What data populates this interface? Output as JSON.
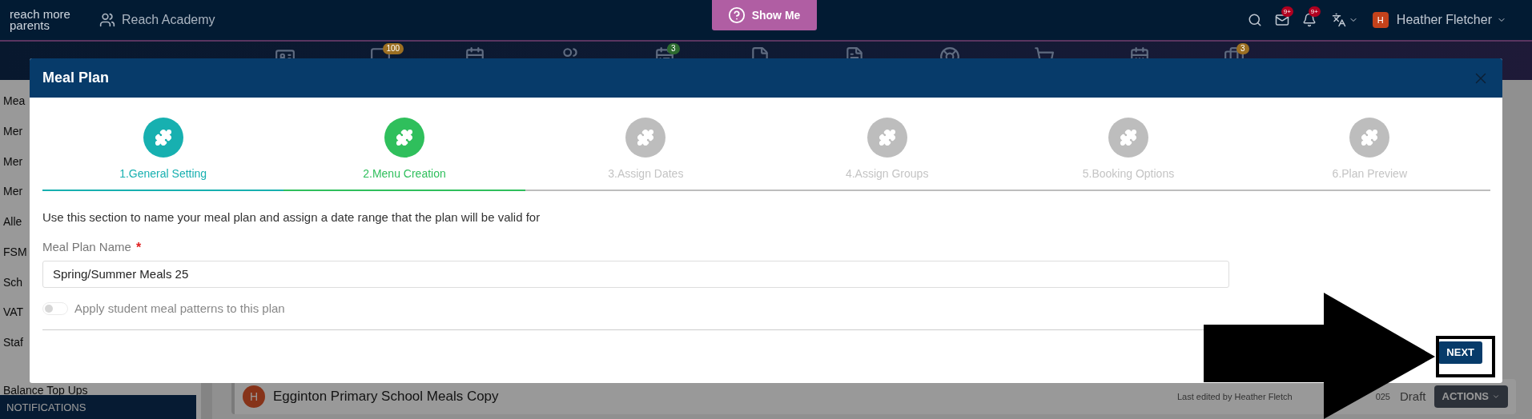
{
  "topbar": {
    "logo": [
      "reach more",
      "parents"
    ],
    "school": "Reach Academy",
    "show_me": "Show Me",
    "mail_badge": "9+",
    "bell_badge": "9+",
    "avatar": "H",
    "user": "Heather Fletcher"
  },
  "nav_badges": [
    {
      "text": "100",
      "color": "#9c6f22"
    },
    {
      "text": "3",
      "color": "#2d6a2f"
    },
    {
      "text": "3",
      "color": "#9c6f22"
    }
  ],
  "sidebar": {
    "items": [
      "Mea",
      "Mer",
      "Mer",
      "Mer",
      "Alle",
      "FSM",
      "Sch",
      "VAT",
      "Staf",
      "Balance Top Ups"
    ],
    "section": "NOTIFICATIONS"
  },
  "plan_row": {
    "avatar": "H",
    "name": "Egginton Primary School Meals Copy",
    "edited": "Last edited by Heather Fletch",
    "edited_tail": "025",
    "status": "Draft",
    "actions": "ACTIONS"
  },
  "modal": {
    "title": "Meal Plan",
    "steps": [
      {
        "label": "1.General Setting",
        "color": "#17b0b0"
      },
      {
        "label": "2.Menu Creation",
        "color": "#2fbf5c"
      },
      {
        "label": "3.Assign Dates",
        "color": "#bdbdbd"
      },
      {
        "label": "4.Assign Groups",
        "color": "#bdbdbd"
      },
      {
        "label": "5.Booking Options",
        "color": "#bdbdbd"
      },
      {
        "label": "6.Plan Preview",
        "color": "#bdbdbd"
      }
    ],
    "intro": "Use this section to name your meal plan and assign a date range that the plan will be valid for",
    "name_label": "Meal Plan Name",
    "required_mark": "*",
    "name_value": "Spring/Summer Meals 25",
    "toggle": {
      "label": "Apply student meal patterns to this plan",
      "on": false,
      "disabled": true
    },
    "next": "NEXT"
  }
}
